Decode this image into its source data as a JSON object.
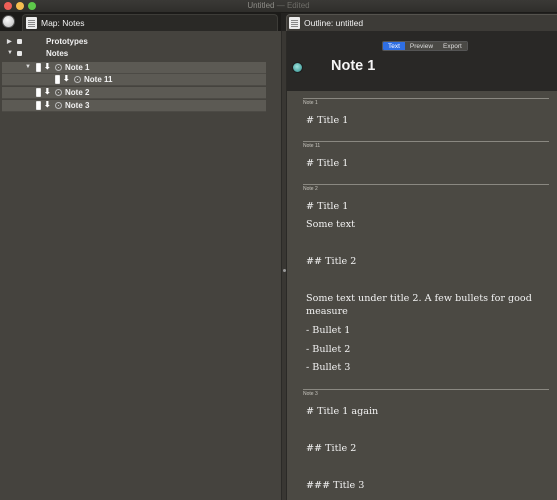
{
  "window": {
    "title": "Untitled",
    "title_separator": " — ",
    "status": "Edited"
  },
  "tabs": {
    "left_label": "Map: Notes",
    "right_label": "Outline: untitled"
  },
  "map": {
    "rows": [
      {
        "label": "Prototypes"
      },
      {
        "label": "Notes"
      },
      {
        "label": "Note 1"
      },
      {
        "label": "Note 11"
      },
      {
        "label": "Note 2"
      },
      {
        "label": "Note 3"
      }
    ]
  },
  "outline": {
    "view_modes": [
      "Text",
      "Preview",
      "Export"
    ],
    "active_mode": "Text",
    "note_title": "Note 1",
    "sections": [
      {
        "label": "Note 1",
        "lines": [
          "# Title 1"
        ]
      },
      {
        "label": "Note 11",
        "lines": [
          "# Title 1"
        ]
      },
      {
        "label": "Note 2",
        "lines": [
          "# Title 1",
          "Some text",
          "## Title 2",
          "Some text under title 2. A few bullets for good measure",
          "- Bullet 1",
          "- Bullet 2",
          "- Bullet 3"
        ]
      },
      {
        "label": "Note 3",
        "lines": [
          "# Title 1 again",
          "## Title 2",
          "### Title 3"
        ]
      }
    ]
  },
  "colors": {
    "accent": "#2f6fe4",
    "panel_bg": "#45433e",
    "outline_bg": "#4b4943",
    "header_bg": "#292826",
    "selection": "#5c5a54"
  }
}
